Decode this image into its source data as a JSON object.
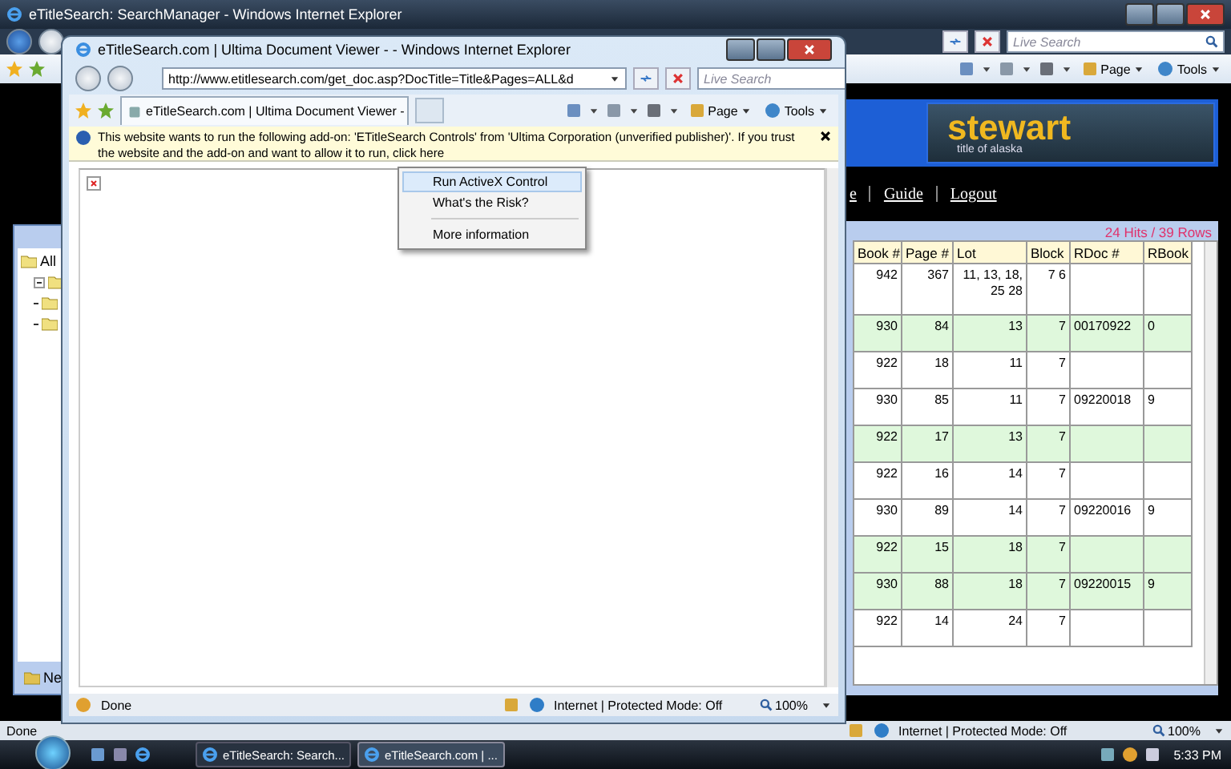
{
  "back_window": {
    "title": "eTitleSearch: SearchManager - Windows Internet Explorer",
    "search": {
      "placeholder": "Live Search"
    },
    "toolbar": [
      "Page",
      "Tools"
    ],
    "tree": {
      "items": [
        {
          "label": "All",
          "children": [
            {
              "expanded": true
            },
            {
              "expanded": false
            },
            {
              "expanded": false
            }
          ]
        }
      ],
      "new_button": "Ne"
    },
    "logo": {
      "name": "stewart",
      "tagline": "title of alaska"
    },
    "nav_links": [
      "e",
      "Guide",
      "Logout"
    ],
    "hits": "24 Hits / 39 Rows",
    "table": {
      "columns": [
        "Book #",
        "Page #",
        "Lot",
        "Block",
        "RDoc #",
        "RBook"
      ],
      "rows": [
        {
          "cells": [
            "942",
            "367",
            "11, 13, 18, 25 28",
            "7 6",
            "",
            ""
          ],
          "highlighted": false
        },
        {
          "cells": [
            "930",
            "84",
            "13",
            "7",
            "00170922",
            "0"
          ],
          "highlighted": true
        },
        {
          "cells": [
            "922",
            "18",
            "11",
            "7",
            "",
            ""
          ],
          "highlighted": false
        },
        {
          "cells": [
            "930",
            "85",
            "11",
            "7",
            "09220018",
            "9"
          ],
          "highlighted": false
        },
        {
          "cells": [
            "922",
            "17",
            "13",
            "7",
            "",
            ""
          ],
          "highlighted": true
        },
        {
          "cells": [
            "922",
            "16",
            "14",
            "7",
            "",
            ""
          ],
          "highlighted": false
        },
        {
          "cells": [
            "930",
            "89",
            "14",
            "7",
            "09220016",
            "9"
          ],
          "highlighted": false
        },
        {
          "cells": [
            "922",
            "15",
            "18",
            "7",
            "",
            ""
          ],
          "highlighted": true
        },
        {
          "cells": [
            "930",
            "88",
            "18",
            "7",
            "09220015",
            "9"
          ],
          "highlighted": true
        },
        {
          "cells": [
            "922",
            "14",
            "24",
            "7",
            "",
            ""
          ],
          "highlighted": false
        }
      ]
    },
    "status_bar": {
      "text": "Done",
      "zone": "Internet | Protected Mode: Off",
      "zoom": "100%"
    }
  },
  "front_window": {
    "title": "eTitleSearch.com | Ultima Document Viewer - - Windows Internet Explorer",
    "address": "http://www.etitlesearch.com/get_doc.asp?DocTitle=Title&Pages=ALL&d",
    "search": {
      "placeholder": "Live Search"
    },
    "tab": "eTitleSearch.com | Ultima Document Viewer -",
    "toolbar": [
      "Page",
      "Tools"
    ],
    "info_bar": "This website wants to run the following add-on: 'ETitleSearch Controls' from 'Ultima Corporation (unverified publisher)'. If you trust the website and the add-on and want to allow it to run, click here",
    "status_bar": {
      "text": "Done",
      "zone": "Internet | Protected Mode: Off",
      "zoom": "100%"
    }
  },
  "context_menu": [
    {
      "label": "Run ActiveX Control",
      "selected": true,
      "separated": false
    },
    {
      "label": "What's the Risk?",
      "selected": false,
      "separated": false
    },
    {
      "label": "More information",
      "selected": false,
      "separated": true
    }
  ],
  "taskbar": {
    "buttons": [
      {
        "label": "eTitleSearch: Search...",
        "selected": false
      },
      {
        "label": "eTitleSearch.com | ...",
        "selected": true
      }
    ],
    "clock": "5:33 PM"
  }
}
